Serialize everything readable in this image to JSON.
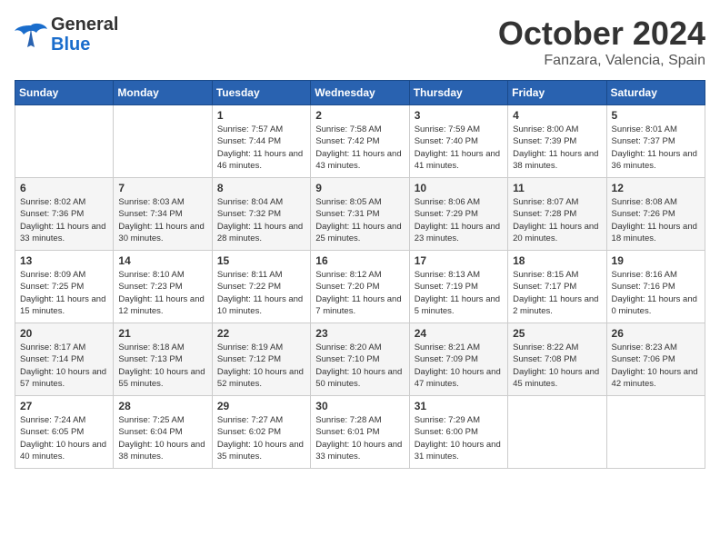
{
  "header": {
    "logo_line1": "General",
    "logo_line2": "Blue",
    "month": "October 2024",
    "location": "Fanzara, Valencia, Spain"
  },
  "weekdays": [
    "Sunday",
    "Monday",
    "Tuesday",
    "Wednesday",
    "Thursday",
    "Friday",
    "Saturday"
  ],
  "weeks": [
    [
      {
        "day": "",
        "info": ""
      },
      {
        "day": "",
        "info": ""
      },
      {
        "day": "1",
        "info": "Sunrise: 7:57 AM\nSunset: 7:44 PM\nDaylight: 11 hours and 46 minutes."
      },
      {
        "day": "2",
        "info": "Sunrise: 7:58 AM\nSunset: 7:42 PM\nDaylight: 11 hours and 43 minutes."
      },
      {
        "day": "3",
        "info": "Sunrise: 7:59 AM\nSunset: 7:40 PM\nDaylight: 11 hours and 41 minutes."
      },
      {
        "day": "4",
        "info": "Sunrise: 8:00 AM\nSunset: 7:39 PM\nDaylight: 11 hours and 38 minutes."
      },
      {
        "day": "5",
        "info": "Sunrise: 8:01 AM\nSunset: 7:37 PM\nDaylight: 11 hours and 36 minutes."
      }
    ],
    [
      {
        "day": "6",
        "info": "Sunrise: 8:02 AM\nSunset: 7:36 PM\nDaylight: 11 hours and 33 minutes."
      },
      {
        "day": "7",
        "info": "Sunrise: 8:03 AM\nSunset: 7:34 PM\nDaylight: 11 hours and 30 minutes."
      },
      {
        "day": "8",
        "info": "Sunrise: 8:04 AM\nSunset: 7:32 PM\nDaylight: 11 hours and 28 minutes."
      },
      {
        "day": "9",
        "info": "Sunrise: 8:05 AM\nSunset: 7:31 PM\nDaylight: 11 hours and 25 minutes."
      },
      {
        "day": "10",
        "info": "Sunrise: 8:06 AM\nSunset: 7:29 PM\nDaylight: 11 hours and 23 minutes."
      },
      {
        "day": "11",
        "info": "Sunrise: 8:07 AM\nSunset: 7:28 PM\nDaylight: 11 hours and 20 minutes."
      },
      {
        "day": "12",
        "info": "Sunrise: 8:08 AM\nSunset: 7:26 PM\nDaylight: 11 hours and 18 minutes."
      }
    ],
    [
      {
        "day": "13",
        "info": "Sunrise: 8:09 AM\nSunset: 7:25 PM\nDaylight: 11 hours and 15 minutes."
      },
      {
        "day": "14",
        "info": "Sunrise: 8:10 AM\nSunset: 7:23 PM\nDaylight: 11 hours and 12 minutes."
      },
      {
        "day": "15",
        "info": "Sunrise: 8:11 AM\nSunset: 7:22 PM\nDaylight: 11 hours and 10 minutes."
      },
      {
        "day": "16",
        "info": "Sunrise: 8:12 AM\nSunset: 7:20 PM\nDaylight: 11 hours and 7 minutes."
      },
      {
        "day": "17",
        "info": "Sunrise: 8:13 AM\nSunset: 7:19 PM\nDaylight: 11 hours and 5 minutes."
      },
      {
        "day": "18",
        "info": "Sunrise: 8:15 AM\nSunset: 7:17 PM\nDaylight: 11 hours and 2 minutes."
      },
      {
        "day": "19",
        "info": "Sunrise: 8:16 AM\nSunset: 7:16 PM\nDaylight: 11 hours and 0 minutes."
      }
    ],
    [
      {
        "day": "20",
        "info": "Sunrise: 8:17 AM\nSunset: 7:14 PM\nDaylight: 10 hours and 57 minutes."
      },
      {
        "day": "21",
        "info": "Sunrise: 8:18 AM\nSunset: 7:13 PM\nDaylight: 10 hours and 55 minutes."
      },
      {
        "day": "22",
        "info": "Sunrise: 8:19 AM\nSunset: 7:12 PM\nDaylight: 10 hours and 52 minutes."
      },
      {
        "day": "23",
        "info": "Sunrise: 8:20 AM\nSunset: 7:10 PM\nDaylight: 10 hours and 50 minutes."
      },
      {
        "day": "24",
        "info": "Sunrise: 8:21 AM\nSunset: 7:09 PM\nDaylight: 10 hours and 47 minutes."
      },
      {
        "day": "25",
        "info": "Sunrise: 8:22 AM\nSunset: 7:08 PM\nDaylight: 10 hours and 45 minutes."
      },
      {
        "day": "26",
        "info": "Sunrise: 8:23 AM\nSunset: 7:06 PM\nDaylight: 10 hours and 42 minutes."
      }
    ],
    [
      {
        "day": "27",
        "info": "Sunrise: 7:24 AM\nSunset: 6:05 PM\nDaylight: 10 hours and 40 minutes."
      },
      {
        "day": "28",
        "info": "Sunrise: 7:25 AM\nSunset: 6:04 PM\nDaylight: 10 hours and 38 minutes."
      },
      {
        "day": "29",
        "info": "Sunrise: 7:27 AM\nSunset: 6:02 PM\nDaylight: 10 hours and 35 minutes."
      },
      {
        "day": "30",
        "info": "Sunrise: 7:28 AM\nSunset: 6:01 PM\nDaylight: 10 hours and 33 minutes."
      },
      {
        "day": "31",
        "info": "Sunrise: 7:29 AM\nSunset: 6:00 PM\nDaylight: 10 hours and 31 minutes."
      },
      {
        "day": "",
        "info": ""
      },
      {
        "day": "",
        "info": ""
      }
    ]
  ]
}
